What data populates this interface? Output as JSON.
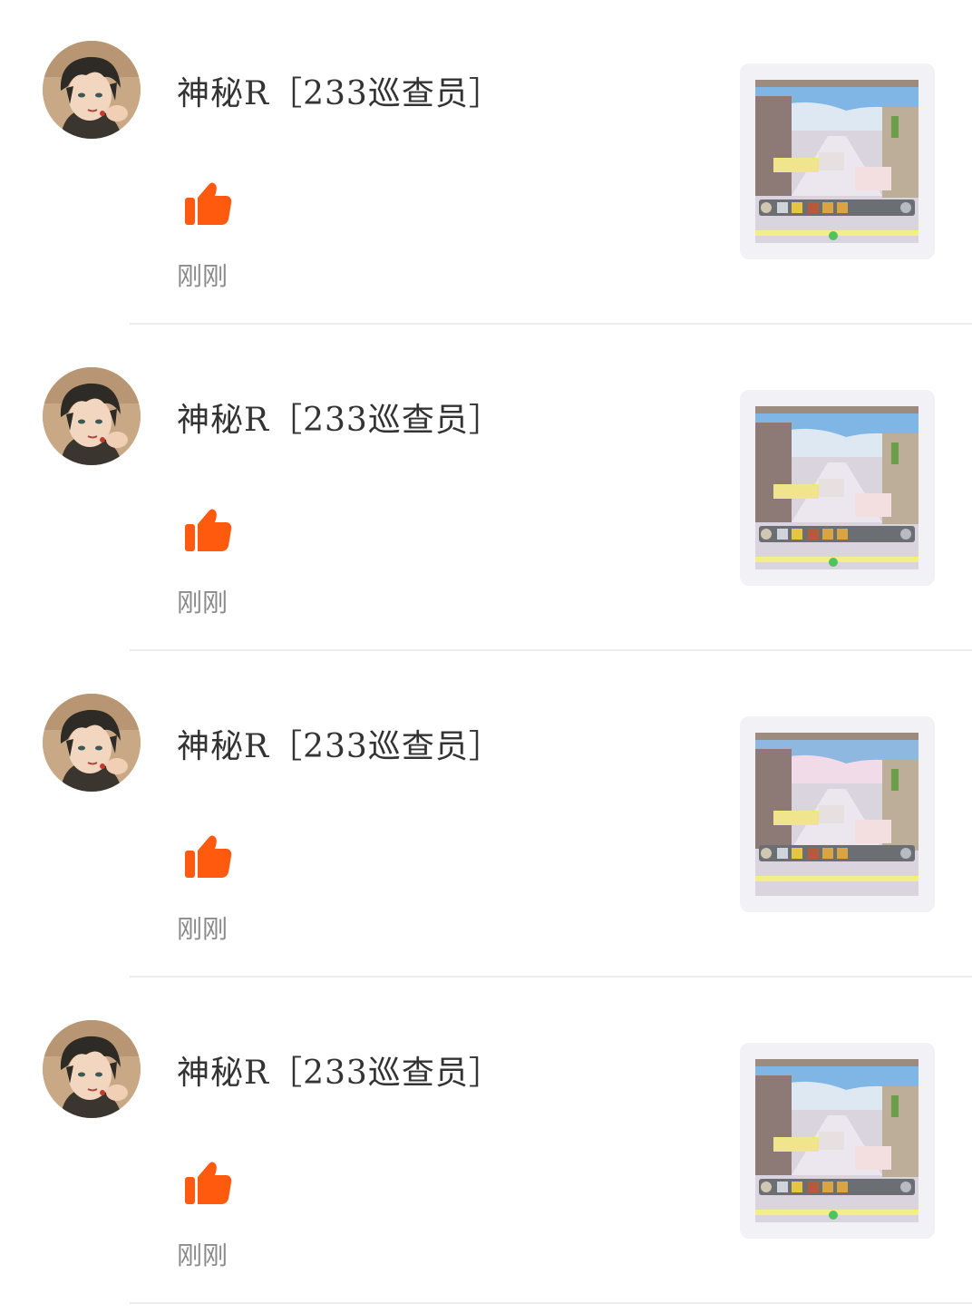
{
  "notifications": [
    {
      "username": "神秘R［233巡查员］",
      "time": "刚刚",
      "action_icon": "thumbs-up-icon",
      "avatar": "anime-boy-avatar",
      "thumbnail": "game-screenshot-thumbnail"
    },
    {
      "username": "神秘R［233巡查员］",
      "time": "刚刚",
      "action_icon": "thumbs-up-icon",
      "avatar": "anime-boy-avatar",
      "thumbnail": "game-screenshot-thumbnail"
    },
    {
      "username": "神秘R［233巡查员］",
      "time": "刚刚",
      "action_icon": "thumbs-up-icon",
      "avatar": "anime-boy-avatar",
      "thumbnail": "game-screenshot-thumbnail"
    },
    {
      "username": "神秘R［233巡查员］",
      "time": "刚刚",
      "action_icon": "thumbs-up-icon",
      "avatar": "anime-boy-avatar",
      "thumbnail": "game-screenshot-thumbnail"
    }
  ],
  "colors": {
    "like_accent": "#ff5a0e",
    "username_text": "#333333",
    "time_text": "#8a8a8a",
    "divider": "#ececec",
    "thumbnail_bg": "#f2f2f6"
  }
}
